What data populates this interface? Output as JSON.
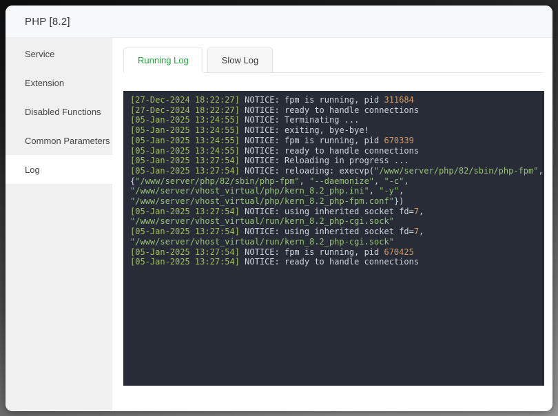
{
  "window": {
    "title": "PHP [8.2]"
  },
  "sidebar": {
    "items": [
      {
        "label": "Service",
        "active": false
      },
      {
        "label": "Extension",
        "active": false
      },
      {
        "label": "Disabled Functions",
        "active": false
      },
      {
        "label": "Common Parameters",
        "active": false
      },
      {
        "label": "Log",
        "active": true
      }
    ]
  },
  "tabs": [
    {
      "label": "Running Log",
      "active": true
    },
    {
      "label": "Slow Log",
      "active": false
    }
  ],
  "log": {
    "colors": {
      "background": "#282c37",
      "ts": "#a4bf5c",
      "txt": "#ced3dc",
      "num": "#d19a66",
      "str": "#98c377"
    },
    "lines": [
      [
        {
          "t": "[27-Dec-2024 18:22:27]",
          "c": "ts"
        },
        {
          "t": " NOTICE: fpm is running, pid ",
          "c": "txt"
        },
        {
          "t": "311684",
          "c": "num"
        }
      ],
      [
        {
          "t": "[27-Dec-2024 18:22:27]",
          "c": "ts"
        },
        {
          "t": " NOTICE: ready to handle connections",
          "c": "txt"
        }
      ],
      [
        {
          "t": "[05-Jan-2025 13:24:55]",
          "c": "ts"
        },
        {
          "t": " NOTICE: Terminating ...",
          "c": "txt"
        }
      ],
      [
        {
          "t": "[05-Jan-2025 13:24:55]",
          "c": "ts"
        },
        {
          "t": " NOTICE: exiting, bye-bye!",
          "c": "txt"
        }
      ],
      [
        {
          "t": "[05-Jan-2025 13:24:55]",
          "c": "ts"
        },
        {
          "t": " NOTICE: fpm is running, pid ",
          "c": "txt"
        },
        {
          "t": "670339",
          "c": "num"
        }
      ],
      [
        {
          "t": "[05-Jan-2025 13:24:55]",
          "c": "ts"
        },
        {
          "t": " NOTICE: ready to handle connections",
          "c": "txt"
        }
      ],
      [
        {
          "t": "[05-Jan-2025 13:27:54]",
          "c": "ts"
        },
        {
          "t": " NOTICE: Reloading in progress ...",
          "c": "txt"
        }
      ],
      [
        {
          "t": "[05-Jan-2025 13:27:54]",
          "c": "ts"
        },
        {
          "t": " NOTICE: reloading: execvp(",
          "c": "txt"
        },
        {
          "t": "\"/www/server/php/82/sbin/php-fpm\"",
          "c": "str"
        },
        {
          "t": ",",
          "c": "txt"
        }
      ],
      [
        {
          "t": "{",
          "c": "txt"
        },
        {
          "t": "\"/www/server/php/82/sbin/php-fpm\"",
          "c": "str"
        },
        {
          "t": ", ",
          "c": "txt"
        },
        {
          "t": "\"--daemonize\"",
          "c": "str"
        },
        {
          "t": ", ",
          "c": "txt"
        },
        {
          "t": "\"-c\"",
          "c": "str"
        },
        {
          "t": ",",
          "c": "txt"
        }
      ],
      [
        {
          "t": "\"/www/server/vhost_virtual/php/kern_8.2_php.ini\"",
          "c": "str"
        },
        {
          "t": ", ",
          "c": "txt"
        },
        {
          "t": "\"-y\"",
          "c": "str"
        },
        {
          "t": ",",
          "c": "txt"
        }
      ],
      [
        {
          "t": "\"/www/server/vhost_virtual/php/kern_8.2_php-fpm.conf\"",
          "c": "str"
        },
        {
          "t": "})",
          "c": "txt"
        }
      ],
      [
        {
          "t": "[05-Jan-2025 13:27:54]",
          "c": "ts"
        },
        {
          "t": " NOTICE: using inherited socket fd=",
          "c": "txt"
        },
        {
          "t": "7",
          "c": "num"
        },
        {
          "t": ",",
          "c": "txt"
        }
      ],
      [
        {
          "t": "\"/www/server/vhost_virtual/run/kern_8.2_php-cgi.sock\"",
          "c": "str"
        }
      ],
      [
        {
          "t": "[05-Jan-2025 13:27:54]",
          "c": "ts"
        },
        {
          "t": " NOTICE: using inherited socket fd=",
          "c": "txt"
        },
        {
          "t": "7",
          "c": "num"
        },
        {
          "t": ",",
          "c": "txt"
        }
      ],
      [
        {
          "t": "\"/www/server/vhost_virtual/run/kern_8.2_php-cgi.sock\"",
          "c": "str"
        }
      ],
      [
        {
          "t": "[05-Jan-2025 13:27:54]",
          "c": "ts"
        },
        {
          "t": " NOTICE: fpm is running, pid ",
          "c": "txt"
        },
        {
          "t": "670425",
          "c": "num"
        }
      ],
      [
        {
          "t": "[05-Jan-2025 13:27:54]",
          "c": "ts"
        },
        {
          "t": " NOTICE: ready to handle connections",
          "c": "txt"
        }
      ]
    ]
  }
}
